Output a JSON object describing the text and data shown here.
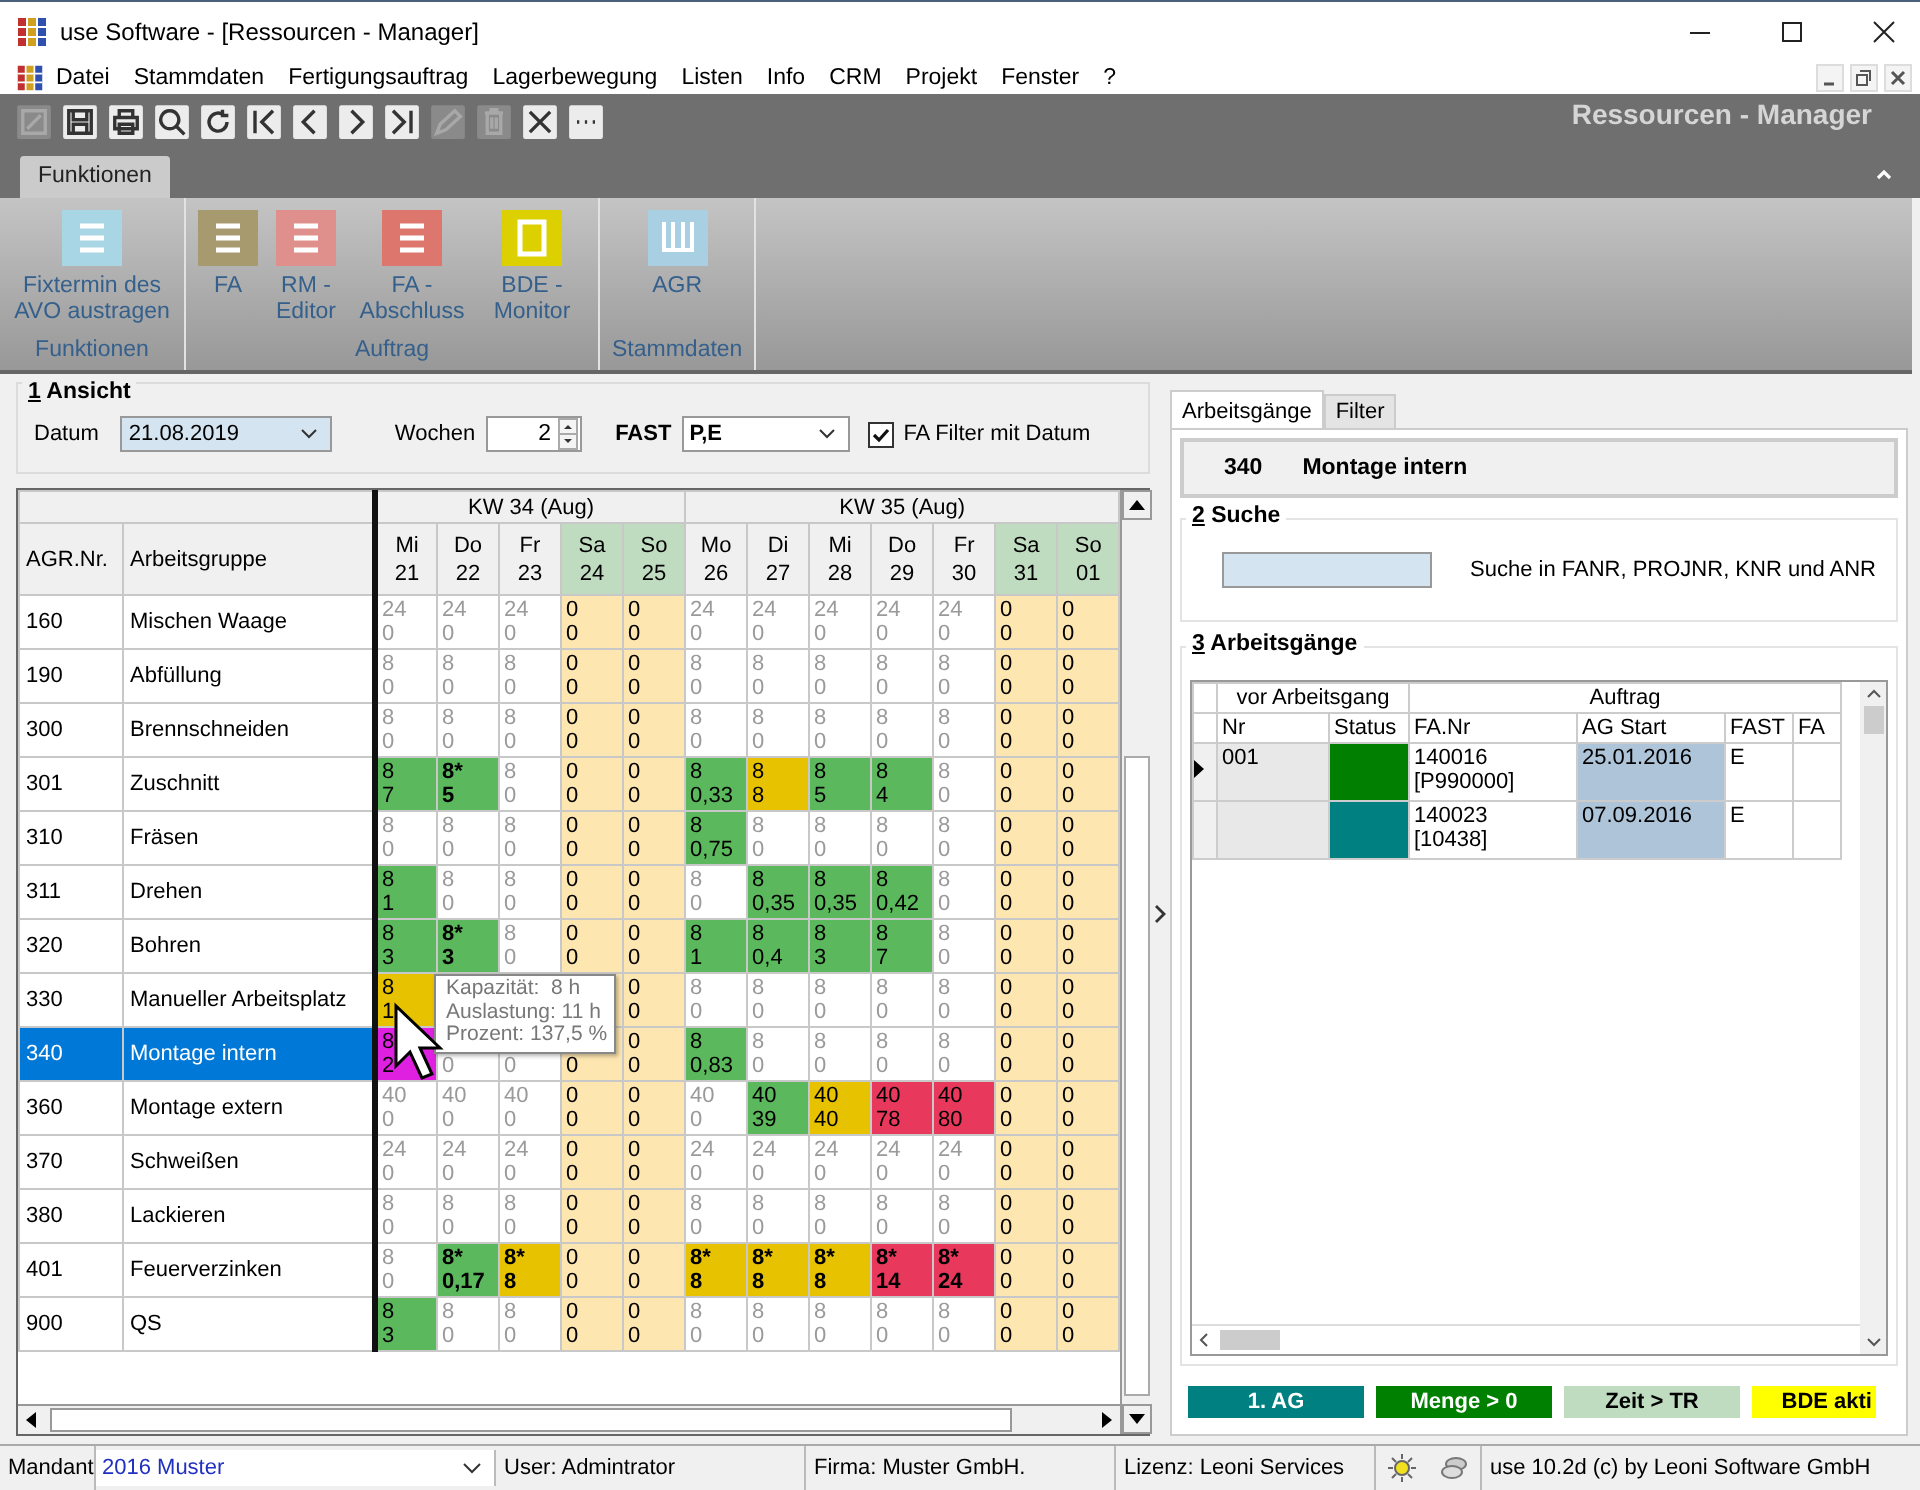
{
  "window": {
    "title": "use Software - [Ressourcen - Manager]"
  },
  "menu": [
    "Datei",
    "Stammdaten",
    "Fertigungsauftrag",
    "Lagerbewegung",
    "Listen",
    "Info",
    "CRM",
    "Projekt",
    "Fenster",
    "?"
  ],
  "toolbar": {
    "title": "Ressourcen - Manager",
    "tools": [
      {
        "kind": "new",
        "disabled": true
      },
      {
        "kind": "save",
        "disabled": false
      },
      {
        "kind": "print",
        "disabled": false
      },
      {
        "kind": "search",
        "disabled": false
      },
      {
        "kind": "refresh",
        "disabled": false
      },
      {
        "kind": "first",
        "disabled": false
      },
      {
        "kind": "prev",
        "disabled": false
      },
      {
        "kind": "next",
        "disabled": false
      },
      {
        "kind": "last",
        "disabled": false
      },
      {
        "kind": "edit",
        "disabled": true
      },
      {
        "kind": "delete",
        "disabled": true
      },
      {
        "kind": "cancel",
        "disabled": false
      },
      {
        "kind": "more",
        "disabled": false
      }
    ]
  },
  "ribbon": {
    "tabs": [
      {
        "label": "Funktionen",
        "selected": true
      }
    ],
    "groups": [
      {
        "label": "Funktionen",
        "buttons": [
          {
            "label": "Fixtermin des AVO austragen",
            "kind": "list",
            "color": "#a9d6e5"
          }
        ]
      },
      {
        "label": "Auftrag",
        "buttons": [
          {
            "label": "FA",
            "kind": "list",
            "color": "#a89a6f"
          },
          {
            "label": "RM - Editor",
            "kind": "list",
            "color": "#e0908c"
          },
          {
            "label": "FA - Abschluss",
            "kind": "list",
            "color": "#dd766d"
          },
          {
            "label": "BDE - Monitor",
            "kind": "frame",
            "color": "#ddd000"
          }
        ]
      },
      {
        "label": "Stammdaten",
        "buttons": [
          {
            "label": "AGR",
            "kind": "columns",
            "color": "#a9d0e2"
          }
        ]
      }
    ]
  },
  "view": {
    "key": "1",
    "title": "Ansicht",
    "date_label": "Datum",
    "date": "21.08.2019",
    "weeks_label": "Wochen",
    "weeks": "2",
    "fast_label": "FAST",
    "fast": "P,E",
    "filter": {
      "label": "FA Filter mit Datum",
      "checked": true
    }
  },
  "grid": {
    "columns": [
      "AGR.Nr.",
      "Arbeitsgruppe"
    ],
    "weeks": [
      {
        "label": "KW 34 (Aug)",
        "days": [
          {
            "weekday": "Mi",
            "date": "21",
            "weekend": false
          },
          {
            "weekday": "Do",
            "date": "22",
            "weekend": false
          },
          {
            "weekday": "Fr",
            "date": "23",
            "weekend": false
          },
          {
            "weekday": "Sa",
            "date": "24",
            "weekend": true
          },
          {
            "weekday": "So",
            "date": "25",
            "weekend": true
          }
        ]
      },
      {
        "label": "KW 35 (Aug)",
        "days": [
          {
            "weekday": "Mo",
            "date": "26",
            "weekend": false
          },
          {
            "weekday": "Di",
            "date": "27",
            "weekend": false
          },
          {
            "weekday": "Mi",
            "date": "28",
            "weekend": false
          },
          {
            "weekday": "Do",
            "date": "29",
            "weekend": false
          },
          {
            "weekday": "Fr",
            "date": "30",
            "weekend": false
          },
          {
            "weekday": "Sa",
            "date": "31",
            "weekend": true
          },
          {
            "weekday": "So",
            "date": "01",
            "weekend": true
          }
        ]
      }
    ],
    "rows": [
      {
        "number": "160",
        "name": "Mischen Waage",
        "selected": false,
        "cells": [
          {
            "cap": "24",
            "load": "0",
            "kind": "free"
          },
          {
            "cap": "24",
            "load": "0",
            "kind": "free"
          },
          {
            "cap": "24",
            "load": "0",
            "kind": "free"
          },
          {
            "cap": "0",
            "load": "0",
            "kind": "weekend"
          },
          {
            "cap": "0",
            "load": "0",
            "kind": "weekend"
          },
          {
            "cap": "24",
            "load": "0",
            "kind": "free"
          },
          {
            "cap": "24",
            "load": "0",
            "kind": "free"
          },
          {
            "cap": "24",
            "load": "0",
            "kind": "free"
          },
          {
            "cap": "24",
            "load": "0",
            "kind": "free"
          },
          {
            "cap": "24",
            "load": "0",
            "kind": "free"
          },
          {
            "cap": "0",
            "load": "0",
            "kind": "weekend"
          },
          {
            "cap": "0",
            "load": "0",
            "kind": "weekend"
          }
        ]
      },
      {
        "number": "190",
        "name": "Abfüllung",
        "selected": false,
        "cells": [
          {
            "cap": "8",
            "load": "0",
            "kind": "free"
          },
          {
            "cap": "8",
            "load": "0",
            "kind": "free"
          },
          {
            "cap": "8",
            "load": "0",
            "kind": "free"
          },
          {
            "cap": "0",
            "load": "0",
            "kind": "weekend"
          },
          {
            "cap": "0",
            "load": "0",
            "kind": "weekend"
          },
          {
            "cap": "8",
            "load": "0",
            "kind": "free"
          },
          {
            "cap": "8",
            "load": "0",
            "kind": "free"
          },
          {
            "cap": "8",
            "load": "0",
            "kind": "free"
          },
          {
            "cap": "8",
            "load": "0",
            "kind": "free"
          },
          {
            "cap": "8",
            "load": "0",
            "kind": "free"
          },
          {
            "cap": "0",
            "load": "0",
            "kind": "weekend"
          },
          {
            "cap": "0",
            "load": "0",
            "kind": "weekend"
          }
        ]
      },
      {
        "number": "300",
        "name": "Brennschneiden",
        "selected": false,
        "cells": [
          {
            "cap": "8",
            "load": "0",
            "kind": "free"
          },
          {
            "cap": "8",
            "load": "0",
            "kind": "free"
          },
          {
            "cap": "8",
            "load": "0",
            "kind": "free"
          },
          {
            "cap": "0",
            "load": "0",
            "kind": "weekend"
          },
          {
            "cap": "0",
            "load": "0",
            "kind": "weekend"
          },
          {
            "cap": "8",
            "load": "0",
            "kind": "free"
          },
          {
            "cap": "8",
            "load": "0",
            "kind": "free"
          },
          {
            "cap": "8",
            "load": "0",
            "kind": "free"
          },
          {
            "cap": "8",
            "load": "0",
            "kind": "free"
          },
          {
            "cap": "8",
            "load": "0",
            "kind": "free"
          },
          {
            "cap": "0",
            "load": "0",
            "kind": "weekend"
          },
          {
            "cap": "0",
            "load": "0",
            "kind": "weekend"
          }
        ]
      },
      {
        "number": "301",
        "name": "Zuschnitt",
        "selected": false,
        "cells": [
          {
            "cap": "8",
            "load": "7",
            "kind": "ok"
          },
          {
            "cap": "8*",
            "load": "5",
            "kind": "ok-fixed"
          },
          {
            "cap": "8",
            "load": "0",
            "kind": "free"
          },
          {
            "cap": "0",
            "load": "0",
            "kind": "weekend"
          },
          {
            "cap": "0",
            "load": "0",
            "kind": "weekend"
          },
          {
            "cap": "8",
            "load": "0,33",
            "kind": "ok"
          },
          {
            "cap": "8",
            "load": "8",
            "kind": "warn"
          },
          {
            "cap": "8",
            "load": "5",
            "kind": "ok"
          },
          {
            "cap": "8",
            "load": "4",
            "kind": "ok"
          },
          {
            "cap": "8",
            "load": "0",
            "kind": "free"
          },
          {
            "cap": "0",
            "load": "0",
            "kind": "weekend"
          },
          {
            "cap": "0",
            "load": "0",
            "kind": "weekend"
          }
        ]
      },
      {
        "number": "310",
        "name": "Fräsen",
        "selected": false,
        "cells": [
          {
            "cap": "8",
            "load": "0",
            "kind": "free"
          },
          {
            "cap": "8",
            "load": "0",
            "kind": "free"
          },
          {
            "cap": "8",
            "load": "0",
            "kind": "free"
          },
          {
            "cap": "0",
            "load": "0",
            "kind": "weekend"
          },
          {
            "cap": "0",
            "load": "0",
            "kind": "weekend"
          },
          {
            "cap": "8",
            "load": "0,75",
            "kind": "ok"
          },
          {
            "cap": "8",
            "load": "0",
            "kind": "free"
          },
          {
            "cap": "8",
            "load": "0",
            "kind": "free"
          },
          {
            "cap": "8",
            "load": "0",
            "kind": "free"
          },
          {
            "cap": "8",
            "load": "0",
            "kind": "free"
          },
          {
            "cap": "0",
            "load": "0",
            "kind": "weekend"
          },
          {
            "cap": "0",
            "load": "0",
            "kind": "weekend"
          }
        ]
      },
      {
        "number": "311",
        "name": "Drehen",
        "selected": false,
        "cells": [
          {
            "cap": "8",
            "load": "1",
            "kind": "ok"
          },
          {
            "cap": "8",
            "load": "0",
            "kind": "free"
          },
          {
            "cap": "8",
            "load": "0",
            "kind": "free"
          },
          {
            "cap": "0",
            "load": "0",
            "kind": "weekend"
          },
          {
            "cap": "0",
            "load": "0",
            "kind": "weekend"
          },
          {
            "cap": "8",
            "load": "0",
            "kind": "free"
          },
          {
            "cap": "8",
            "load": "0,35",
            "kind": "ok"
          },
          {
            "cap": "8",
            "load": "0,35",
            "kind": "ok"
          },
          {
            "cap": "8",
            "load": "0,42",
            "kind": "ok"
          },
          {
            "cap": "8",
            "load": "0",
            "kind": "free"
          },
          {
            "cap": "0",
            "load": "0",
            "kind": "weekend"
          },
          {
            "cap": "0",
            "load": "0",
            "kind": "weekend"
          }
        ]
      },
      {
        "number": "320",
        "name": "Bohren",
        "selected": false,
        "cells": [
          {
            "cap": "8",
            "load": "3",
            "kind": "ok"
          },
          {
            "cap": "8*",
            "load": "3",
            "kind": "ok-fixed"
          },
          {
            "cap": "8",
            "load": "0",
            "kind": "free"
          },
          {
            "cap": "0",
            "load": "0",
            "kind": "weekend"
          },
          {
            "cap": "0",
            "load": "0",
            "kind": "weekend"
          },
          {
            "cap": "8",
            "load": "1",
            "kind": "ok"
          },
          {
            "cap": "8",
            "load": "0,4",
            "kind": "ok"
          },
          {
            "cap": "8",
            "load": "3",
            "kind": "ok"
          },
          {
            "cap": "8",
            "load": "7",
            "kind": "ok"
          },
          {
            "cap": "8",
            "load": "0",
            "kind": "free"
          },
          {
            "cap": "0",
            "load": "0",
            "kind": "weekend"
          },
          {
            "cap": "0",
            "load": "0",
            "kind": "weekend"
          }
        ]
      },
      {
        "number": "330",
        "name": "Manueller Arbeitsplatz",
        "selected": false,
        "cells": [
          {
            "cap": "8",
            "load": "1",
            "kind": "warn"
          },
          {
            "kind": "free"
          },
          {
            "kind": "free"
          },
          {
            "kind": "weekend"
          },
          {
            "cap": "0",
            "load": "0",
            "kind": "weekend"
          },
          {
            "cap": "8",
            "load": "0",
            "kind": "free"
          },
          {
            "cap": "8",
            "load": "0",
            "kind": "free"
          },
          {
            "cap": "8",
            "load": "0",
            "kind": "free"
          },
          {
            "cap": "8",
            "load": "0",
            "kind": "free"
          },
          {
            "cap": "8",
            "load": "0",
            "kind": "free"
          },
          {
            "cap": "0",
            "load": "0",
            "kind": "weekend"
          },
          {
            "cap": "0",
            "load": "0",
            "kind": "weekend"
          }
        ]
      },
      {
        "number": "340",
        "name": "Montage intern",
        "selected": true,
        "cells": [
          {
            "cap": "8",
            "load": "2",
            "kind": "hot"
          },
          {
            "load": "0",
            "kind": "free"
          },
          {
            "load": "0",
            "kind": "free"
          },
          {
            "load": "0",
            "kind": "weekend"
          },
          {
            "cap": "0",
            "load": "0",
            "kind": "weekend"
          },
          {
            "cap": "8",
            "load": "0,83",
            "kind": "ok"
          },
          {
            "cap": "8",
            "load": "0",
            "kind": "free"
          },
          {
            "cap": "8",
            "load": "0",
            "kind": "free"
          },
          {
            "cap": "8",
            "load": "0",
            "kind": "free"
          },
          {
            "cap": "8",
            "load": "0",
            "kind": "free"
          },
          {
            "cap": "0",
            "load": "0",
            "kind": "weekend"
          },
          {
            "cap": "0",
            "load": "0",
            "kind": "weekend"
          }
        ]
      },
      {
        "number": "360",
        "name": "Montage extern",
        "selected": false,
        "cells": [
          {
            "cap": "40",
            "load": "0",
            "kind": "free"
          },
          {
            "cap": "40",
            "load": "0",
            "kind": "free"
          },
          {
            "cap": "40",
            "load": "0",
            "kind": "free"
          },
          {
            "cap": "0",
            "load": "0",
            "kind": "weekend"
          },
          {
            "cap": "0",
            "load": "0",
            "kind": "weekend"
          },
          {
            "cap": "40",
            "load": "0",
            "kind": "free"
          },
          {
            "cap": "40",
            "load": "39",
            "kind": "ok"
          },
          {
            "cap": "40",
            "load": "40",
            "kind": "warn"
          },
          {
            "cap": "40",
            "load": "78",
            "kind": "over"
          },
          {
            "cap": "40",
            "load": "80",
            "kind": "over"
          },
          {
            "cap": "0",
            "load": "0",
            "kind": "weekend"
          },
          {
            "cap": "0",
            "load": "0",
            "kind": "weekend"
          }
        ]
      },
      {
        "number": "370",
        "name": "Schweißen",
        "selected": false,
        "cells": [
          {
            "cap": "24",
            "load": "0",
            "kind": "free"
          },
          {
            "cap": "24",
            "load": "0",
            "kind": "free"
          },
          {
            "cap": "24",
            "load": "0",
            "kind": "free"
          },
          {
            "cap": "0",
            "load": "0",
            "kind": "weekend"
          },
          {
            "cap": "0",
            "load": "0",
            "kind": "weekend"
          },
          {
            "cap": "24",
            "load": "0",
            "kind": "free"
          },
          {
            "cap": "24",
            "load": "0",
            "kind": "free"
          },
          {
            "cap": "24",
            "load": "0",
            "kind": "free"
          },
          {
            "cap": "24",
            "load": "0",
            "kind": "free"
          },
          {
            "cap": "24",
            "load": "0",
            "kind": "free"
          },
          {
            "cap": "0",
            "load": "0",
            "kind": "weekend"
          },
          {
            "cap": "0",
            "load": "0",
            "kind": "weekend"
          }
        ]
      },
      {
        "number": "380",
        "name": "Lackieren",
        "selected": false,
        "cells": [
          {
            "cap": "8",
            "load": "0",
            "kind": "free"
          },
          {
            "cap": "8",
            "load": "0",
            "kind": "free"
          },
          {
            "cap": "8",
            "load": "0",
            "kind": "free"
          },
          {
            "cap": "0",
            "load": "0",
            "kind": "weekend"
          },
          {
            "cap": "0",
            "load": "0",
            "kind": "weekend"
          },
          {
            "cap": "8",
            "load": "0",
            "kind": "free"
          },
          {
            "cap": "8",
            "load": "0",
            "kind": "free"
          },
          {
            "cap": "8",
            "load": "0",
            "kind": "free"
          },
          {
            "cap": "8",
            "load": "0",
            "kind": "free"
          },
          {
            "cap": "8",
            "load": "0",
            "kind": "free"
          },
          {
            "cap": "0",
            "load": "0",
            "kind": "weekend"
          },
          {
            "cap": "0",
            "load": "0",
            "kind": "weekend"
          }
        ]
      },
      {
        "number": "401",
        "name": "Feuerverzinken",
        "selected": false,
        "cells": [
          {
            "cap": "8",
            "load": "0",
            "kind": "free"
          },
          {
            "cap": "8*",
            "load": "0,17",
            "kind": "ok-fixed"
          },
          {
            "cap": "8*",
            "load": "8",
            "kind": "warn-fixed"
          },
          {
            "cap": "0",
            "load": "0",
            "kind": "weekend"
          },
          {
            "cap": "0",
            "load": "0",
            "kind": "weekend"
          },
          {
            "cap": "8*",
            "load": "8",
            "kind": "warn-fixed"
          },
          {
            "cap": "8*",
            "load": "8",
            "kind": "warn-fixed"
          },
          {
            "cap": "8*",
            "load": "8",
            "kind": "warn-fixed"
          },
          {
            "cap": "8*",
            "load": "14",
            "kind": "over-fixed"
          },
          {
            "cap": "8*",
            "load": "24",
            "kind": "over-fixed"
          },
          {
            "cap": "0",
            "load": "0",
            "kind": "weekend"
          },
          {
            "cap": "0",
            "load": "0",
            "kind": "weekend"
          }
        ]
      },
      {
        "number": "900",
        "name": "QS",
        "selected": false,
        "cells": [
          {
            "cap": "8",
            "load": "3",
            "kind": "ok"
          },
          {
            "cap": "8",
            "load": "0",
            "kind": "free"
          },
          {
            "cap": "8",
            "load": "0",
            "kind": "free"
          },
          {
            "cap": "0",
            "load": "0",
            "kind": "weekend"
          },
          {
            "cap": "0",
            "load": "0",
            "kind": "weekend"
          },
          {
            "cap": "8",
            "load": "0",
            "kind": "free"
          },
          {
            "cap": "8",
            "load": "0",
            "kind": "free"
          },
          {
            "cap": "8",
            "load": "0",
            "kind": "free"
          },
          {
            "cap": "8",
            "load": "0",
            "kind": "free"
          },
          {
            "cap": "8",
            "load": "0",
            "kind": "free"
          },
          {
            "cap": "0",
            "load": "0",
            "kind": "weekend"
          },
          {
            "cap": "0",
            "load": "0",
            "kind": "weekend"
          }
        ]
      }
    ],
    "tooltip": {
      "lines": [
        "Kapazität:  8 h",
        "Auslastung: 11 h",
        "Prozent: 137,5 %"
      ]
    }
  },
  "detail": {
    "tabs": [
      {
        "label": "Arbeitsgänge",
        "selected": true
      },
      {
        "label": "Filter",
        "selected": false
      }
    ],
    "header": {
      "number": "340",
      "name": "Montage intern"
    },
    "search": {
      "key": "2",
      "title": "Suche",
      "hint": "Suche in FANR, PROJNR, KNR und ANR"
    },
    "operations": {
      "key": "3",
      "title": "Arbeitsgänge",
      "groups": [
        {
          "label": "vor Arbeitsgang",
          "columns": [
            "Nr",
            "Status"
          ]
        },
        {
          "label": "Auftrag",
          "columns": [
            "FA.Nr",
            "AG Start",
            "FAST",
            "FA"
          ]
        }
      ],
      "rows": [
        {
          "current": true,
          "nr": "001",
          "color": "#007f00",
          "fa_nr": "140016",
          "fa_ref": "[P990000]",
          "ag_start": "25.01.2016",
          "fast": "E"
        },
        {
          "current": false,
          "color": "#008080",
          "fa_nr": "140023",
          "fa_ref": "[10438]",
          "ag_start": "07.09.2016",
          "fast": "E"
        }
      ]
    },
    "legend": [
      {
        "label": "1. AG",
        "color": "#008080"
      },
      {
        "label": "Menge > 0",
        "color": "#008000"
      },
      {
        "label": "Zeit > TR",
        "color": "#c0dcc0"
      },
      {
        "label": "BDE akti",
        "color": "#ffff00"
      }
    ]
  },
  "status_bar": {
    "client_label": "Mandant",
    "client": "2016 Muster",
    "user": "User: Admintrator",
    "company": "Firma: Muster GmbH.",
    "license": "Lizenz: Leoni Services",
    "version": "use 10.2d (c) by Leoni Software GmbH"
  }
}
